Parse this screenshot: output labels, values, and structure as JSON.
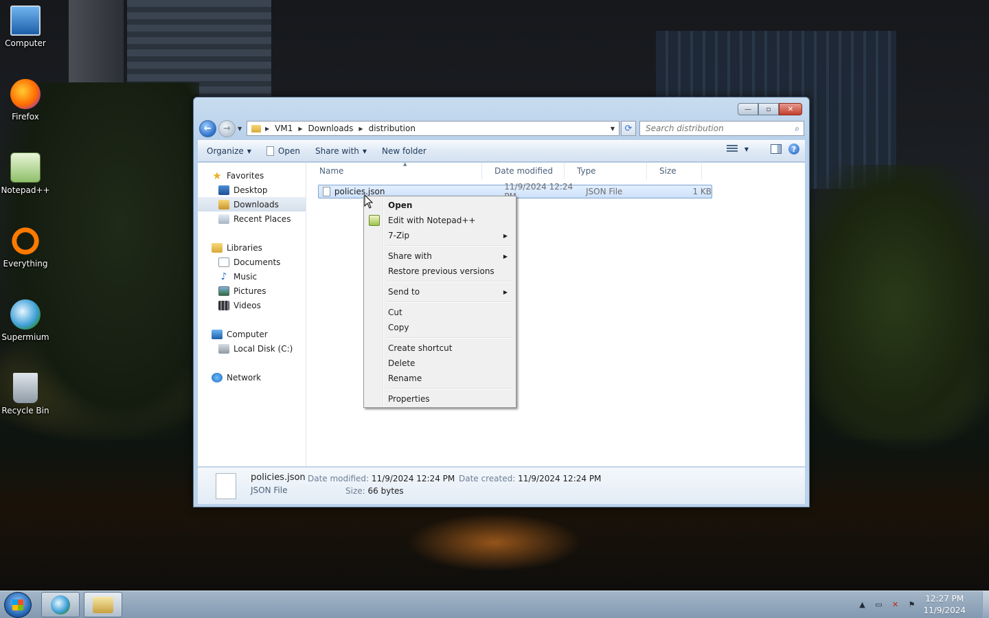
{
  "desktop": {
    "icons": [
      {
        "label": "Computer",
        "icon": "computer-icon"
      },
      {
        "label": "Firefox",
        "icon": "firefox-icon"
      },
      {
        "label": "Notepad++",
        "icon": "notepad-plus-plus-icon"
      },
      {
        "label": "Everything",
        "icon": "everything-icon"
      },
      {
        "label": "Supermium",
        "icon": "supermium-icon"
      },
      {
        "label": "Recycle Bin",
        "icon": "recycle-bin-icon"
      }
    ]
  },
  "explorer": {
    "caption": {
      "minimize": "—",
      "maximize": "▫",
      "close": "✕"
    },
    "breadcrumb": [
      "VM1",
      "Downloads",
      "distribution"
    ],
    "search": {
      "placeholder": "Search distribution"
    },
    "toolbar": {
      "organize": "Organize",
      "open": "Open",
      "share_with": "Share with",
      "new_folder": "New folder"
    },
    "nav": {
      "favorites": "Favorites",
      "desktop": "Desktop",
      "downloads": "Downloads",
      "recent_places": "Recent Places",
      "libraries": "Libraries",
      "documents": "Documents",
      "music": "Music",
      "pictures": "Pictures",
      "videos": "Videos",
      "computer": "Computer",
      "local_disk": "Local Disk (C:)",
      "network": "Network"
    },
    "columns": {
      "name": "Name",
      "date_modified": "Date modified",
      "type": "Type",
      "size": "Size"
    },
    "files": [
      {
        "name": "policies.json",
        "date_modified": "11/9/2024 12:24 PM",
        "type": "JSON File",
        "size": "1 KB"
      }
    ],
    "details": {
      "name": "policies.json",
      "type": "JSON File",
      "date_modified_label": "Date modified:",
      "date_modified": "11/9/2024 12:24 PM",
      "date_created_label": "Date created:",
      "date_created": "11/9/2024 12:24 PM",
      "size_label": "Size:",
      "size": "66 bytes"
    }
  },
  "context_menu": {
    "open": "Open",
    "edit_notepad": "Edit with Notepad++",
    "zip": "7-Zip",
    "share_with": "Share with",
    "restore": "Restore previous versions",
    "send_to": "Send to",
    "cut": "Cut",
    "copy": "Copy",
    "create_shortcut": "Create shortcut",
    "delete": "Delete",
    "rename": "Rename",
    "properties": "Properties"
  },
  "taskbar": {
    "time": "12:27 PM",
    "date": "11/9/2024"
  }
}
